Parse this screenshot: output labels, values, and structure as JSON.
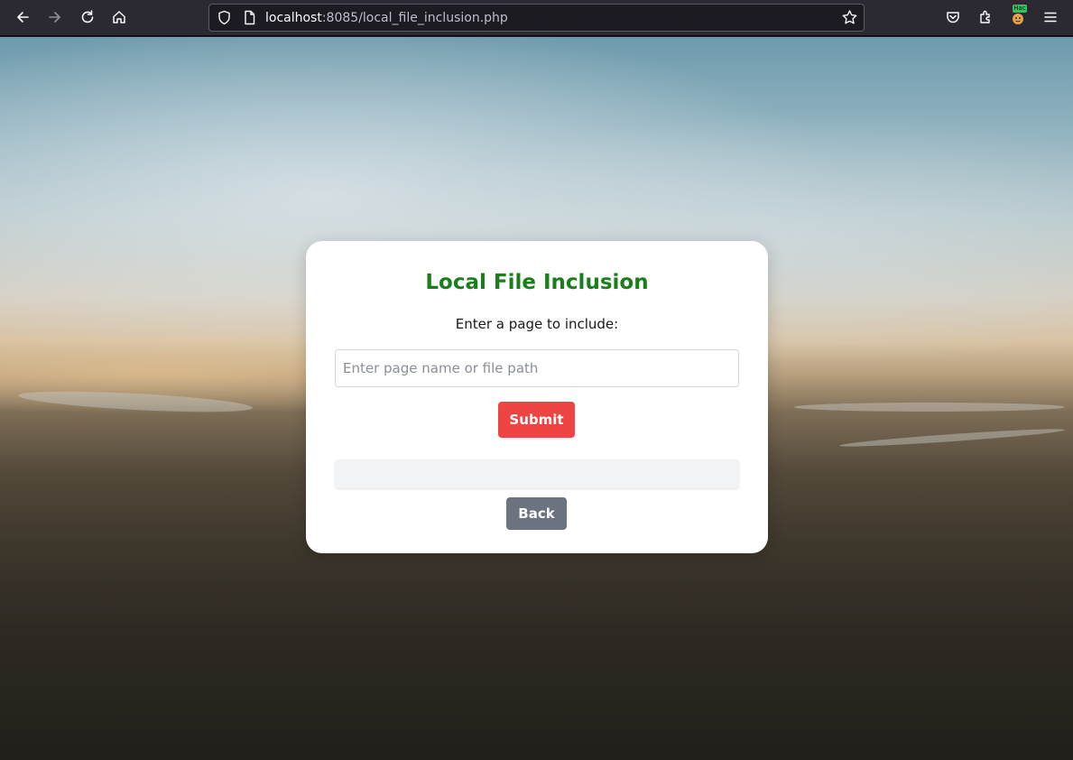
{
  "browser": {
    "url_host": "localhost",
    "url_rest": ":8085/local_file_inclusion.php",
    "extension_badge": "Hac",
    "icons": [
      "back-arrow-icon",
      "forward-arrow-icon",
      "reload-icon",
      "home-icon",
      "shield-icon",
      "page-icon",
      "star-icon",
      "pocket-icon",
      "extensions-icon",
      "extension-avatar-icon",
      "menu-icon"
    ]
  },
  "card": {
    "title": "Local File Inclusion",
    "prompt": "Enter a page to include:",
    "input_placeholder": "Enter page name or file path",
    "input_value": "",
    "submit_label": "Submit",
    "result_text": "",
    "back_label": "Back"
  },
  "colors": {
    "title": "#1a7f1a",
    "submit_bg": "#ef4444",
    "back_bg": "#6b7280",
    "browser_toolbar": "#2b2a33"
  }
}
